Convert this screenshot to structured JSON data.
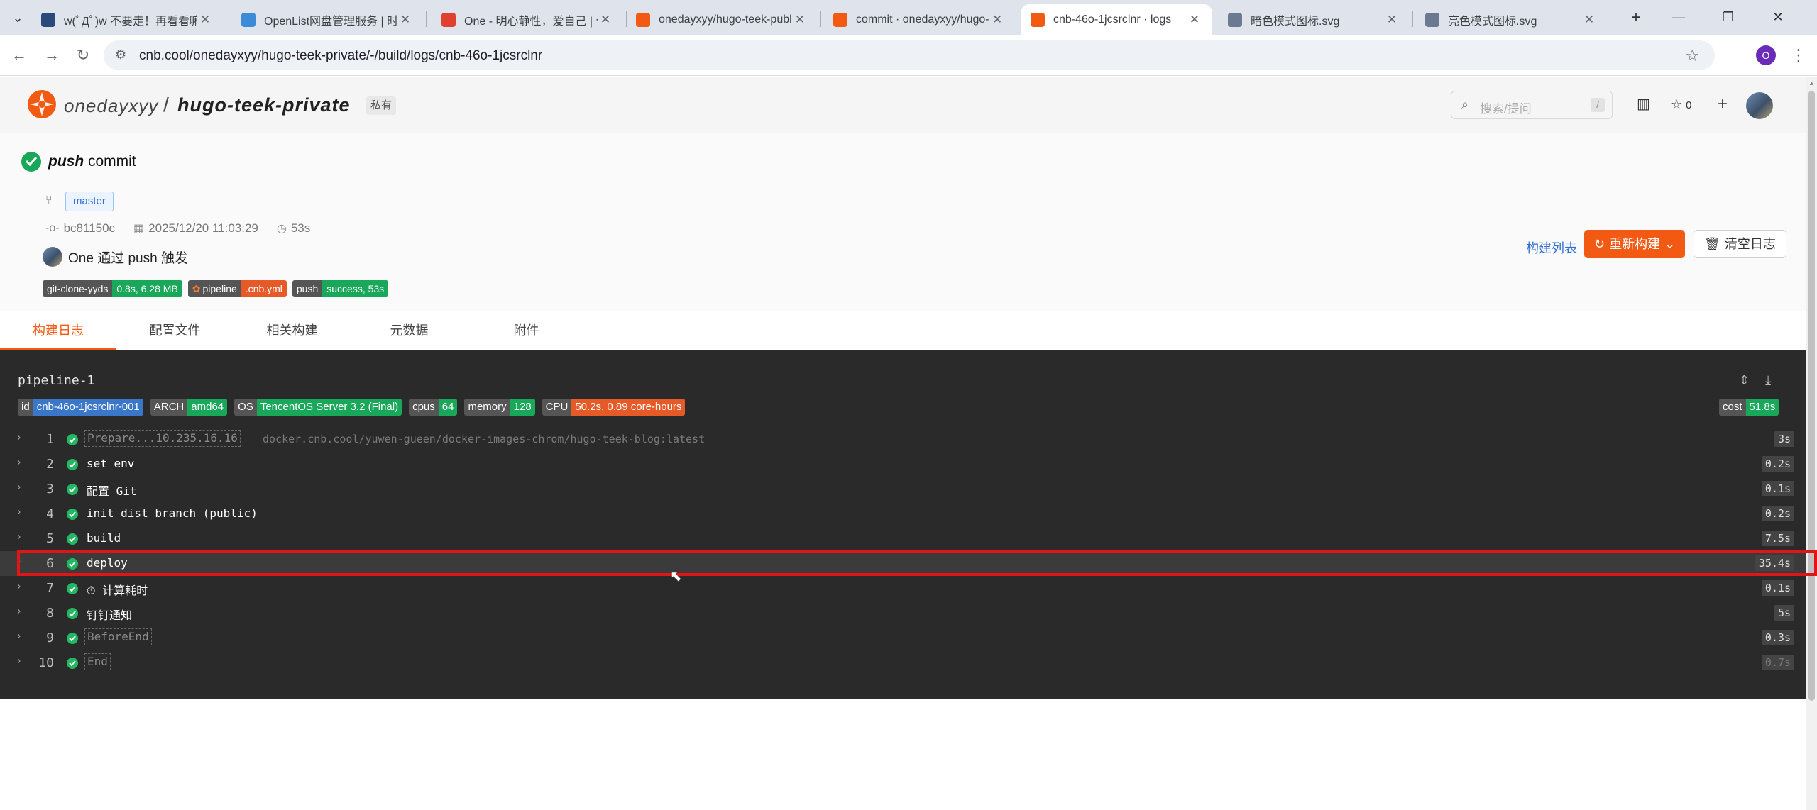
{
  "browser": {
    "tabs": [
      {
        "title": "w(ﾟДﾟ)w 不要走！再看看嘛！",
        "active": false,
        "color": "#2b4a7a"
      },
      {
        "title": "OpenList网盘管理服务 | 时光",
        "active": false,
        "color": "#3b8bd6"
      },
      {
        "title": "One - 明心静性，爱自己 | 个",
        "active": false,
        "color": "#e0402f"
      },
      {
        "title": "onedayxyy/hugo-teek-publi",
        "active": false,
        "color": "#f25a14"
      },
      {
        "title": "commit · onedayxyy/hugo-t",
        "active": false,
        "color": "#f25a14"
      },
      {
        "title": "cnb-46o-1jcsrclnr · logs",
        "active": true,
        "color": "#f25a14"
      },
      {
        "title": "暗色模式图标.svg",
        "active": false,
        "color": "#6b7a90"
      },
      {
        "title": "亮色模式图标.svg",
        "active": false,
        "color": "#6b7a90"
      }
    ],
    "url": "cnb.cool/onedayxyy/hugo-teek-private/-/build/logs/cnb-46o-1jcsrclnr",
    "profile_initial": "O"
  },
  "repo": {
    "owner": "onedayxyy",
    "slash": "/",
    "name": "hugo-teek-private",
    "visibility": "私有",
    "search_placeholder": "搜索/提问",
    "search_kbd": "/",
    "star_count": "0"
  },
  "build": {
    "event": "push",
    "title": "commit",
    "branch": "master",
    "commit_sha": "bc81150c",
    "date": "2025/12/20 11:03:29",
    "duration": "53s",
    "trigger_text": "One 通过 push 触发",
    "badges": [
      {
        "key": "git-clone-yyds",
        "value": "0.8s, 6.28 MB",
        "color": "#19a75a",
        "icon": false
      },
      {
        "key": "pipeline",
        "value": ".cnb.yml",
        "color": "#e65a28",
        "icon": true
      },
      {
        "key": "push",
        "value": "success, 53s",
        "color": "#19a75a",
        "icon": false
      }
    ],
    "actions": {
      "list_label": "构建列表",
      "rebuild_label": "重新构建",
      "clear_label": "清空日志"
    }
  },
  "page_tabs": [
    "构建日志",
    "配置文件",
    "相关构建",
    "元数据",
    "附件"
  ],
  "pipeline": {
    "name": "pipeline-1",
    "info": [
      {
        "key": "id",
        "value": "cnb-46o-1jcsrclnr-001",
        "color": "#3b77c9"
      },
      {
        "key": "ARCH",
        "value": "amd64",
        "color": "#19a75a"
      },
      {
        "key": "OS",
        "value": "TencentOS Server 3.2 (Final)",
        "color": "#19a75a"
      },
      {
        "key": "cpus",
        "value": "64",
        "color": "#19a75a"
      },
      {
        "key": "memory",
        "value": "128",
        "color": "#19a75a"
      },
      {
        "key": "CPU",
        "value": "50.2s, 0.89 core-hours",
        "color": "#e65a28"
      }
    ],
    "cost": {
      "key": "cost",
      "value": "51.8s",
      "color": "#19a75a"
    },
    "steps": [
      {
        "num": "1",
        "label": "Prepare...10.235.16.16",
        "sub": "docker.cnb.cool/yuwen-gueen/docker-images-chrom/hugo-teek-blog:latest",
        "duration": "3s",
        "dim": true
      },
      {
        "num": "2",
        "label": "set env",
        "sub": "",
        "duration": "0.2s",
        "dim": false
      },
      {
        "num": "3",
        "label": "配置 Git",
        "sub": "",
        "duration": "0.1s",
        "dim": false
      },
      {
        "num": "4",
        "label": "init dist branch (public)",
        "sub": "",
        "duration": "0.2s",
        "dim": false
      },
      {
        "num": "5",
        "label": "build",
        "sub": "",
        "duration": "7.5s",
        "dim": false
      },
      {
        "num": "6",
        "label": "deploy",
        "sub": "",
        "duration": "35.4s",
        "dim": false
      },
      {
        "num": "7",
        "label": "⏱ 计算耗时",
        "sub": "",
        "duration": "0.1s",
        "dim": false
      },
      {
        "num": "8",
        "label": "钉钉通知",
        "sub": "",
        "duration": "5s",
        "dim": false
      },
      {
        "num": "9",
        "label": "BeforeEnd",
        "sub": "",
        "duration": "0.3s",
        "dim": true
      },
      {
        "num": "10",
        "label": "End",
        "sub": "",
        "duration": "0.7s",
        "dim": true
      }
    ]
  }
}
